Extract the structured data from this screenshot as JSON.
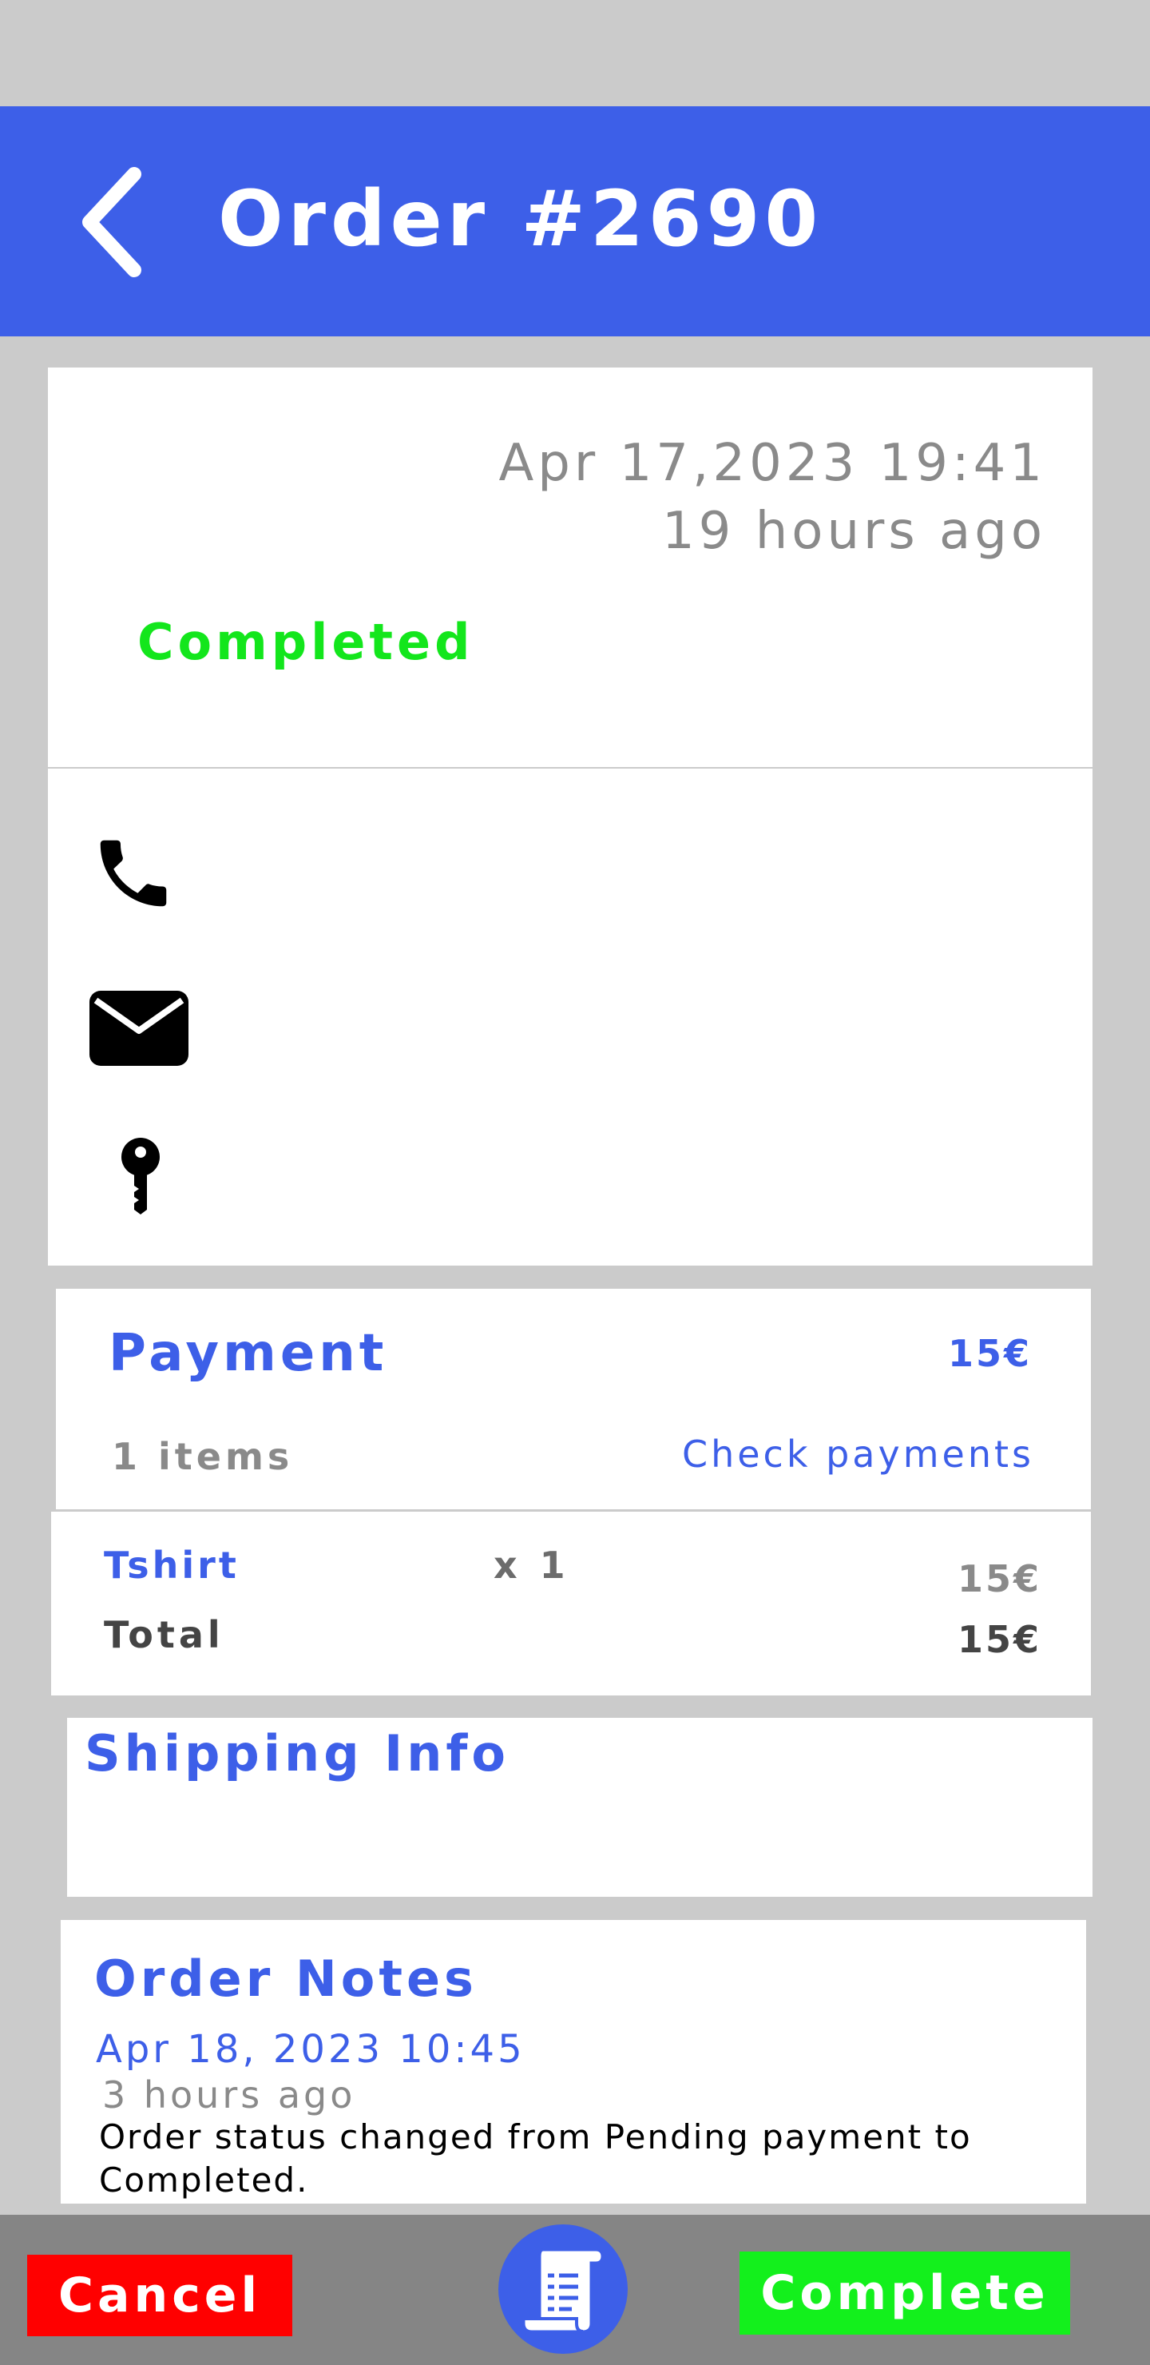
{
  "header": {
    "title": "Order #2690",
    "back_icon": "chevron-left-icon",
    "background": "#3d5fe8"
  },
  "order": {
    "date": "Apr 17,2023 19:41",
    "time_ago": "19 hours ago",
    "status": "Completed",
    "status_color": "#13e61c"
  },
  "contact": {
    "icons": [
      "phone-icon",
      "mail-icon",
      "key-icon"
    ]
  },
  "payment": {
    "title": "Payment",
    "amount": "15€",
    "items_count": "1 items",
    "check_payments_label": "Check payments",
    "line_items": [
      {
        "name": "Tshirt",
        "qty": "x 1",
        "price": "15€"
      }
    ],
    "total_label": "Total",
    "total_value": "15€"
  },
  "shipping": {
    "title": "Shipping Info"
  },
  "notes": {
    "title": "Order Notes",
    "entries": [
      {
        "date": "Apr 18, 2023 10:45",
        "time_ago": "3 hours ago",
        "text": "Order status changed from Pending payment to Completed."
      }
    ]
  },
  "bottom_bar": {
    "cancel_label": "Cancel",
    "cancel_color": "#ff0000",
    "receipt_icon": "receipt-icon",
    "complete_label": "Complete",
    "complete_color": "#13f01c"
  }
}
